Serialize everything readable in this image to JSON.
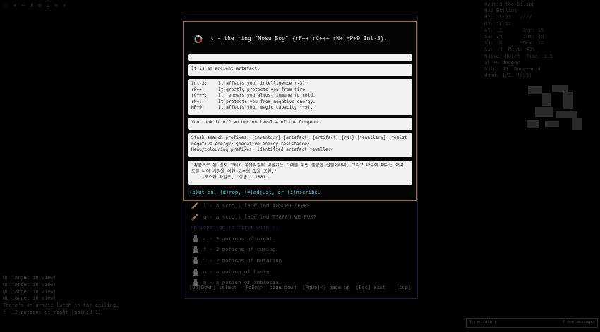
{
  "background": {
    "top_left_text": "ⓘ ⎈ ⋯ ⊞ ⊠ ⊡ ⊕ ⊗",
    "stats": [
      "Hybrid the Dilipp",
      "Hub Billipt",
      "HP: 31/33   ////",
      "MP: 11/11",
      "AC:  9       Str: 15",
      "EV: 14       Int: 10",
      "SH:  0       Dex: 12",
      "XL:  6  Next: 43%",
      "Noise: quiet  Time: 3.5",
      "a) +0 dagger",
      "Gold: 43  Dungeon:4",
      "Wand: 1/3  (0.5)"
    ],
    "message_log": [
      "No target in view!",
      "No target in view!",
      "No target in view!",
      "No target in view!",
      "There's an ornate latch in the ceiling.",
      "f - 2 potions of might (gained 1)"
    ],
    "chat": {
      "spectators": "0 spectators",
      "messages": "0 new messages"
    }
  },
  "inventory": {
    "items": [
      {
        "label": "l - a scroll labelled XOSUPH XEPPE",
        "icon": "scroll-icon",
        "header": false
      },
      {
        "label": "q - a scroll labelled TIRFEU WE FUXT",
        "icon": "scroll-icon",
        "header": false
      },
      {
        "label": "Potions    (go to first with !)",
        "icon": "",
        "header": true
      },
      {
        "label": "c - 3 potions of might",
        "icon": "potion-icon",
        "header": false
      },
      {
        "label": "f - 2 potions of curing",
        "icon": "potion-icon",
        "header": false
      },
      {
        "label": "i - 2 potions of mutation",
        "icon": "potion-icon",
        "header": false
      },
      {
        "label": "m - a potion of haste",
        "icon": "potion-icon",
        "header": false
      },
      {
        "label": "n - a potion of ambrosia",
        "icon": "potion-icon",
        "header": false
      }
    ],
    "footer": "[Up|Down] select  [PgDn|>] page down  [PgUp|<] page up  [Esc] exit",
    "footer_top": "[top]"
  },
  "popup": {
    "title": "t - the ring \"Mosu Bog\" {rF++ rC+++ rN+ MP+9 Int-3}.",
    "title_icon": "ring-icon",
    "empty_box": "",
    "description": "It is an ancient artefact.",
    "properties": [
      {
        "key": "Int-3:",
        "text": "It affects your intelligence (-3)."
      },
      {
        "key": "rF++:",
        "text": "It greatly protects you from fire."
      },
      {
        "key": "rC+++:",
        "text": "It renders you almost immune to cold."
      },
      {
        "key": "rN+:",
        "text": "It protects you from negative energy."
      },
      {
        "key": "MP+9:",
        "text": "It affects your magic capacity (+9)."
      }
    ],
    "origin": "You took it off an orc on level 4 of the Dungeon.",
    "stash": "Stash search prefixes: {inventory} {artefact} {artifact} {rN+} {jewellery} {resist negative energy} {negative energy resistance}",
    "menu_prefixes": "Menu/colouring prefixes: identified artefact jewellery",
    "quote_line1": "\"황금으로 된 반지 그리고 우윳빛깔의 비둘기는 그대를 위한 훌륭한 선물이라네, 그리고 나무에 매다는 애버",
    "quote_line2": "드물 나의 사랑을 위한 고수형 맛을 조한.\"",
    "quote_attr": "    -오스카 와일드, \"상송\". 1881.",
    "prompt": "(p)ut on, (d)rop, (=)adjust, or (i)nscribe."
  },
  "colors": {
    "border": "#a07040",
    "prompt": "#5ad9e8",
    "box_bg": "#f2f2f2"
  }
}
